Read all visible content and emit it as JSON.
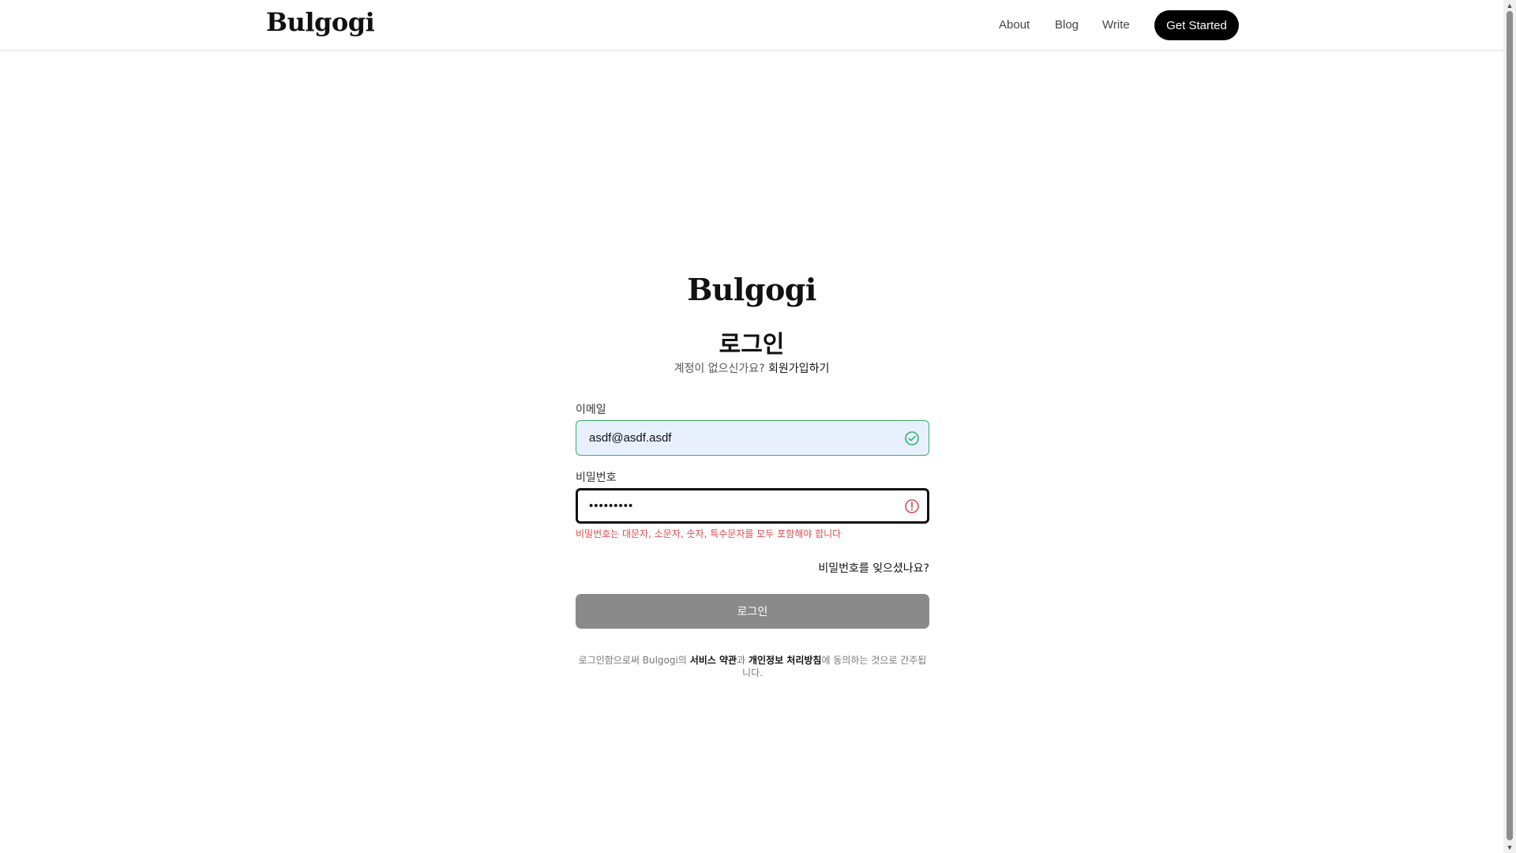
{
  "header": {
    "brand": "Bulgogi",
    "nav": {
      "about": "About",
      "blog": "Blog",
      "write": "Write"
    },
    "cta_label": "Get Started"
  },
  "login": {
    "brand": "Bulgogi",
    "title": "로그인",
    "no_account_text": "계정이 없으신가요? ",
    "signup_link": "회원가입하기",
    "email_label": "이메일",
    "email_value": "asdf@asdf.asdf",
    "email_status_icon": "check-circle-icon",
    "password_label": "비밀번호",
    "password_value": "asdfasdf1",
    "password_status_icon": "error-circle-icon",
    "password_error": "비밀번호는 대문자, 소문자, 숫자, 특수문자를 모두 포함해야 합니다",
    "forgot_password": "비밀번호를 잊으셨나요?",
    "submit_label": "로그인",
    "terms": {
      "prefix": "로그인함으로써 Bulgogi의 ",
      "service_terms": "서비스 약관",
      "and": "과 ",
      "privacy_policy": "개인정보 처리방침",
      "suffix": "에 동의하는 것으로 간주됩니다."
    }
  },
  "colors": {
    "success": "#33b36b",
    "error": "#e5484d",
    "email_bg": "#e8f0fe",
    "button_disabled": "#8a8a8a",
    "cta_bg": "#000000"
  }
}
